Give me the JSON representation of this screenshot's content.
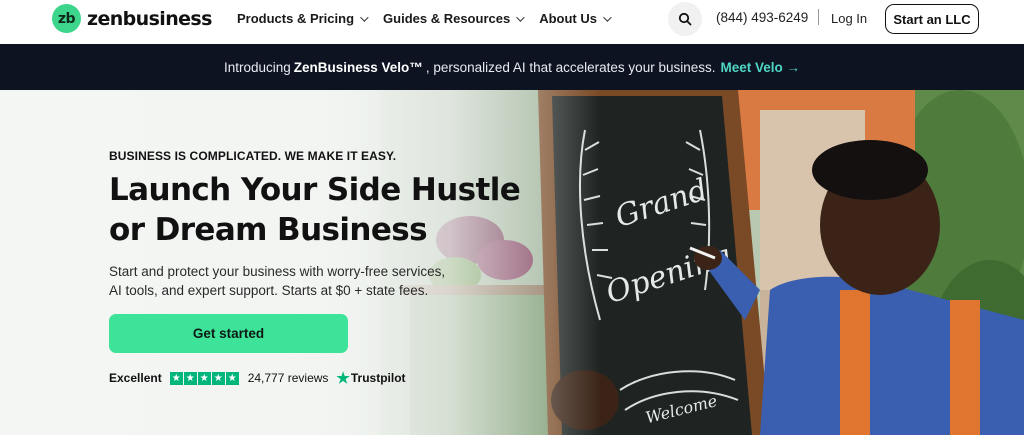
{
  "header": {
    "logo_mark": "zb",
    "logo_word": "zenbusiness",
    "nav": [
      {
        "label": "Products & Pricing"
      },
      {
        "label": "Guides & Resources"
      },
      {
        "label": "About Us"
      }
    ],
    "phone": "(844) 493-6249",
    "login_label": "Log In",
    "cta_label": "Start an LLC"
  },
  "banner": {
    "prefix": "Introducing",
    "product": "ZenBusiness Velo™",
    "suffix": ", personalized AI that accelerates your business.",
    "link_label": "Meet Velo →"
  },
  "hero": {
    "eyebrow": "BUSINESS IS COMPLICATED. WE MAKE IT EASY.",
    "headline_line1": "Launch Your Side Hustle",
    "headline_line2": "or Dream Business",
    "sub_line1": "Start and protect your business with worry-free services,",
    "sub_line2": "AI tools, and expert support. Starts at $0 + state fees.",
    "cta_label": "Get started",
    "rating_label": "Excellent",
    "rating_stars": 5,
    "reviews": "24,777 reviews",
    "trustpilot": "Trustpilot",
    "chalkboard_text_1": "Grand",
    "chalkboard_text_2": "Opening",
    "chalkboard_text_3": "Welcome"
  },
  "colors": {
    "brand_green": "#3ee39a",
    "banner_bg": "#0d1321",
    "banner_link": "#4fd6c6",
    "trustpilot_green": "#00b67a"
  }
}
